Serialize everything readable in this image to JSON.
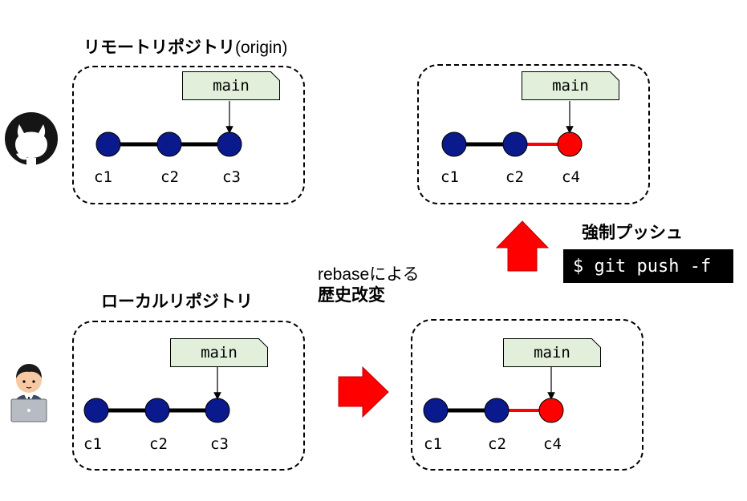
{
  "remote": {
    "title_bold": "リモートリポジトリ",
    "title_plain": "(origin)",
    "before": {
      "branch": "main",
      "commits": [
        "c1",
        "c2",
        "c3"
      ]
    },
    "after": {
      "branch": "main",
      "commits": [
        "c1",
        "c2",
        "c4"
      ]
    }
  },
  "local": {
    "title": "ローカルリポジトリ",
    "before": {
      "branch": "main",
      "commits": [
        "c1",
        "c2",
        "c3"
      ]
    },
    "after": {
      "branch": "main",
      "commits": [
        "c1",
        "c2",
        "c4"
      ]
    }
  },
  "rebase_label": {
    "line1": "rebaseによる",
    "line2": "歴史改変"
  },
  "force_push": {
    "label": "強制プッシュ",
    "command": "$ git push -f"
  },
  "icons": {
    "remote": "github-icon",
    "local": "user-laptop-icon",
    "step_right": "right-arrow-icon",
    "step_up": "up-arrow-icon"
  },
  "colors": {
    "commit": "#0a1a8c",
    "new_commit": "#ff0000",
    "branch_tag": "#e2efda",
    "arrow": "#ff0000"
  }
}
